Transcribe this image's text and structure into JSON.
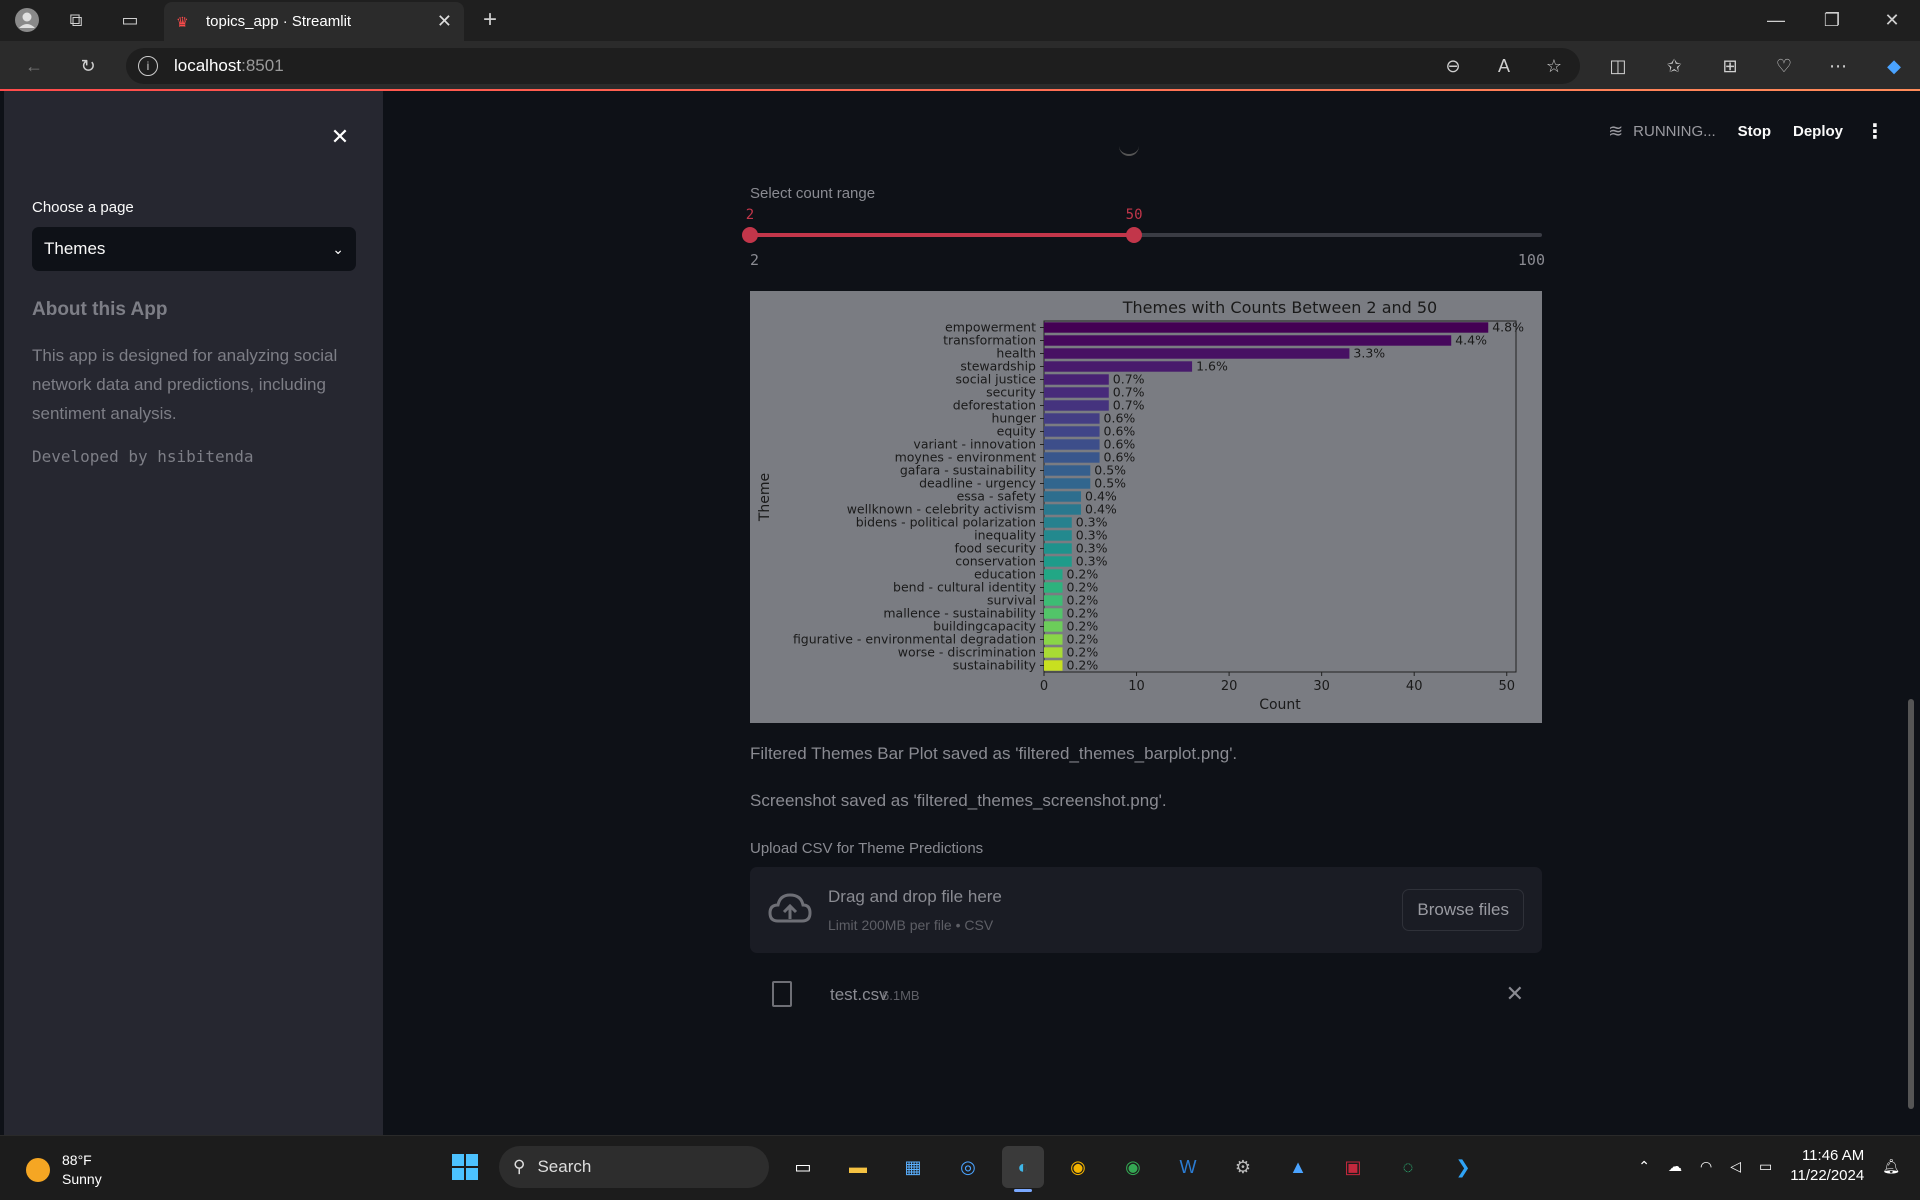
{
  "browser": {
    "tab_title": "topics_app · Streamlit",
    "url_host": "localhost",
    "url_port": ":8501"
  },
  "sidebar": {
    "select_label": "Choose a page",
    "select_value": "Themes",
    "about_title": "About this App",
    "about_text": "This app is designed for analyzing social network data and predictions, including sentiment analysis.",
    "developer": "Developed by hsibitenda"
  },
  "header": {
    "status": "RUNNING...",
    "stop": "Stop",
    "deploy": "Deploy"
  },
  "slider": {
    "label": "Select count range",
    "low": "2",
    "high": "50",
    "min": "2",
    "max": "100"
  },
  "chart_data": {
    "type": "bar",
    "orientation": "horizontal",
    "title": "Themes with Counts Between 2 and 50",
    "xlabel": "Count",
    "ylabel": "Theme",
    "xlim": [
      0,
      51
    ],
    "xticks": [
      "0",
      "10",
      "20",
      "30",
      "40",
      "50"
    ],
    "categories": [
      "empowerment",
      "transformation",
      "health",
      "stewardship",
      "social justice",
      "security",
      "deforestation",
      "hunger",
      "equity",
      "variant - innovation",
      "moynes - environment",
      "gafara - sustainability",
      "deadline - urgency",
      "essa - safety",
      "wellknown - celebrity activism",
      "bidens - political polarization",
      "inequality",
      "food security",
      "conservation",
      "education",
      "bend - cultural identity",
      "survival",
      "mallence - sustainability",
      "buildingcapacity",
      "figurative - environmental degradation",
      "worse - discrimination",
      "sustainability"
    ],
    "values": [
      48,
      44,
      33,
      16,
      7,
      7,
      7,
      6,
      6,
      6,
      6,
      5,
      5,
      4,
      4,
      3,
      3,
      3,
      3,
      2,
      2,
      2,
      2,
      2,
      2,
      2,
      2
    ],
    "labels": [
      "4.8%",
      "4.4%",
      "3.3%",
      "1.6%",
      "0.7%",
      "0.7%",
      "0.7%",
      "0.6%",
      "0.6%",
      "0.6%",
      "0.6%",
      "0.5%",
      "0.5%",
      "0.4%",
      "0.4%",
      "0.3%",
      "0.3%",
      "0.3%",
      "0.3%",
      "0.2%",
      "0.2%",
      "0.2%",
      "0.2%",
      "0.2%",
      "0.2%",
      "0.2%",
      "0.2%"
    ],
    "colormap": "viridis"
  },
  "messages": {
    "saved_plot": "Filtered Themes Bar Plot saved as 'filtered_themes_barplot.png'.",
    "saved_screenshot": "Screenshot saved as 'filtered_themes_screenshot.png'."
  },
  "uploader": {
    "label": "Upload CSV for Theme Predictions",
    "drop_title": "Drag and drop file here",
    "drop_sub": "Limit 200MB per file • CSV",
    "browse": "Browse files",
    "file_name": "test.csv",
    "file_size": "6.1MB"
  },
  "taskbar": {
    "temp": "88°F",
    "condition": "Sunny",
    "search": "Search",
    "time": "11:46 AM",
    "date": "11/22/2024"
  }
}
